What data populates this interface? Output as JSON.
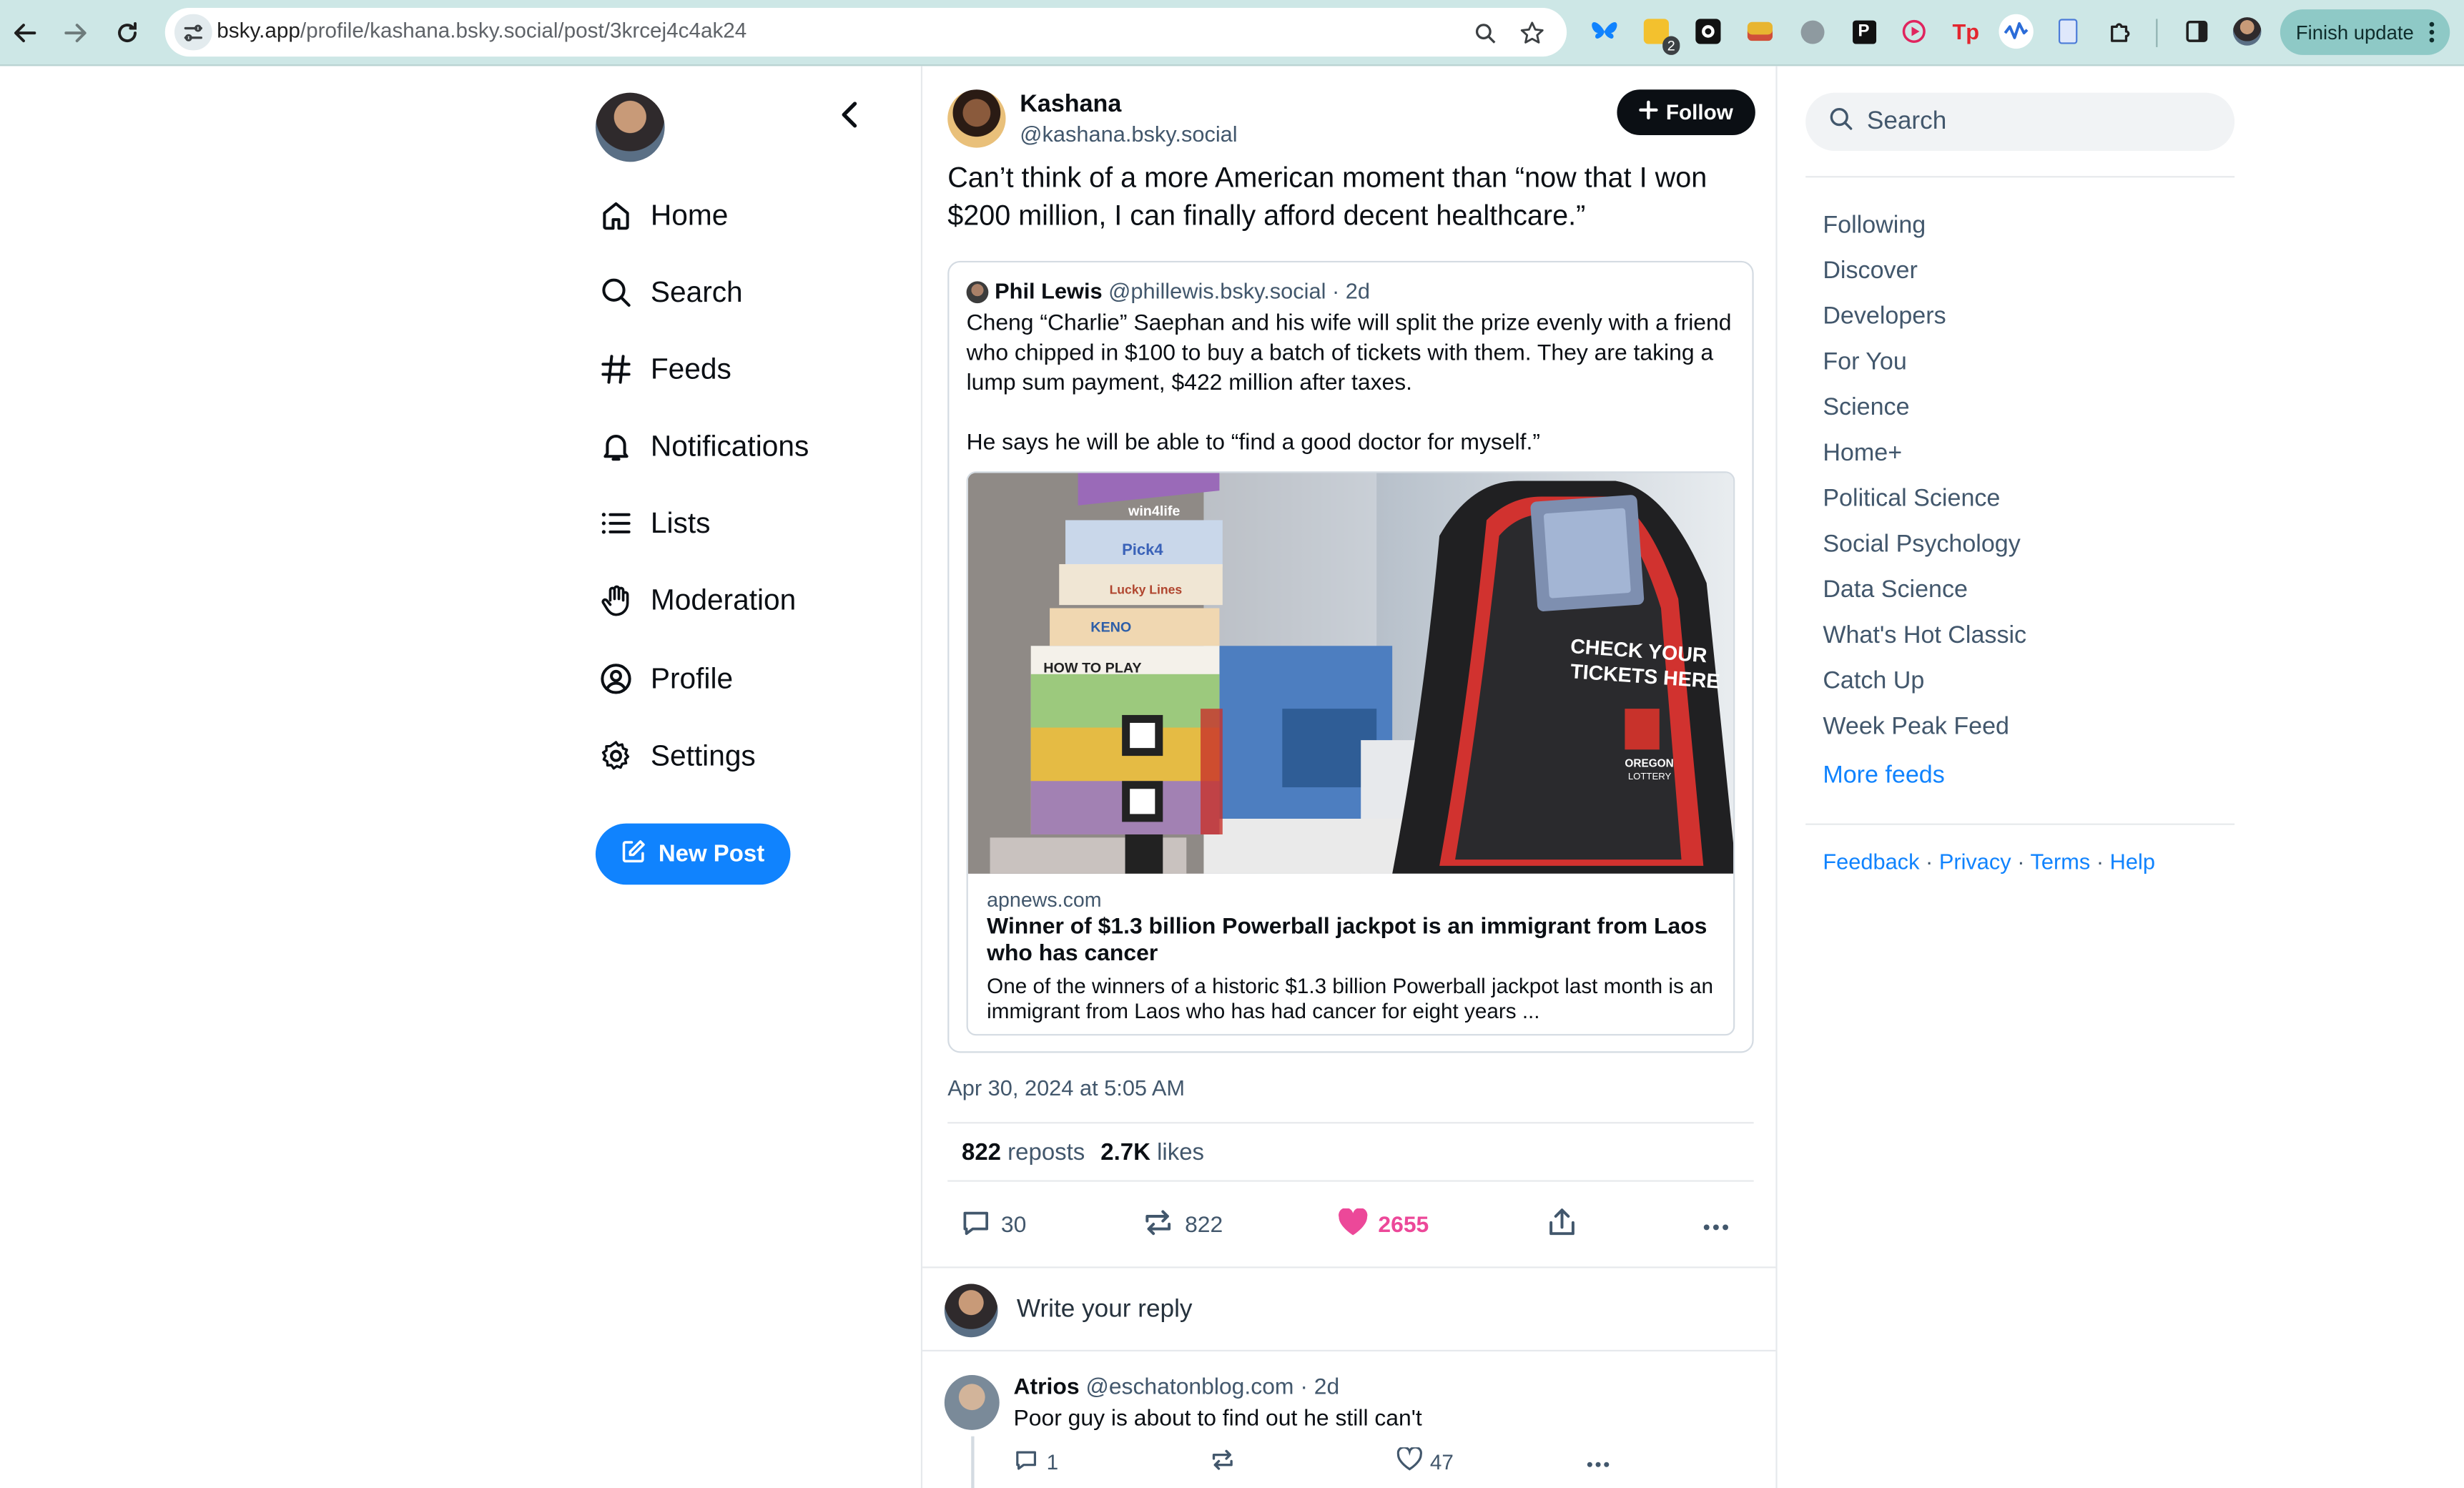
{
  "browser": {
    "url_host": "bsky.app",
    "url_path": "/profile/kashana.bsky.social/post/3krcej4c4ak24",
    "extension_badge": "2",
    "finish_update_label": "Finish update"
  },
  "nav": {
    "items": [
      {
        "label": "Home",
        "icon": "home-icon"
      },
      {
        "label": "Search",
        "icon": "search-icon"
      },
      {
        "label": "Feeds",
        "icon": "hash-icon"
      },
      {
        "label": "Notifications",
        "icon": "bell-icon"
      },
      {
        "label": "Lists",
        "icon": "list-icon"
      },
      {
        "label": "Moderation",
        "icon": "hand-icon"
      },
      {
        "label": "Profile",
        "icon": "user-circle-icon"
      },
      {
        "label": "Settings",
        "icon": "gear-icon"
      }
    ],
    "new_post_label": "New Post"
  },
  "post": {
    "author_name": "Kashana",
    "author_handle": "@kashana.bsky.social",
    "follow_label": "Follow",
    "text": "Can’t think of a more American moment than “now that I won $200 million, I can finally afford decent healthcare.”",
    "quote": {
      "name": "Phil Lewis",
      "handle": "@phillewis.bsky.social",
      "time": "· 2d",
      "text": "Cheng “Charlie” Saephan and his wife will split the prize evenly with a friend who chipped in $100 to buy a batch of tickets with them. They are taking a lump sum payment, $422 million after taxes.\n\nHe says he will be able to “find a good doctor for myself.”",
      "link": {
        "domain": "apnews.com",
        "title": "Winner of $1.3 billion Powerball jackpot is an immigrant from Laos who has cancer",
        "description": "One of the winners of a historic $1.3 billion Powerball jackpot last month is an immigrant from Laos who has had cancer for eight years ...",
        "image_sign_line1": "CHECK YOUR",
        "image_sign_line2": "TICKETS HERE",
        "image_brand_line1": "OREGON",
        "image_brand_line2": "LOTTERY",
        "image_cards": [
          "win4life",
          "Pick4",
          "Lucky Lines",
          "KENO",
          "HOW TO PLAY"
        ]
      }
    },
    "date": "Apr 30, 2024 at 5:05 AM",
    "reposts_count": "822",
    "reposts_label": "reposts",
    "likes_count": "2.7K",
    "likes_label": "likes",
    "actions": {
      "replies": "30",
      "reposts": "822",
      "likes": "2655"
    },
    "like_color": "#ec4899"
  },
  "reply_prompt": "Write your reply",
  "reply": {
    "name": "Atrios",
    "handle": "@eschatonblog.com",
    "time": "· 2d",
    "text": "Poor guy is about to find out he still can't",
    "replies": "1",
    "likes": "47"
  },
  "right": {
    "search_placeholder": "Search",
    "feeds": [
      "Following",
      "Discover",
      "Developers",
      "For You",
      "Science",
      "Home+",
      "Political Science",
      "Social Psychology",
      "Data Science",
      "What's Hot Classic",
      "Catch Up",
      "Week Peak Feed"
    ],
    "more_feeds": "More feeds",
    "footer": {
      "feedback": "Feedback",
      "privacy": "Privacy",
      "terms": "Terms",
      "help": "Help"
    }
  },
  "colors": {
    "accent": "#1083fe",
    "muted": "#42576c",
    "chrome": "#cde7e6"
  }
}
